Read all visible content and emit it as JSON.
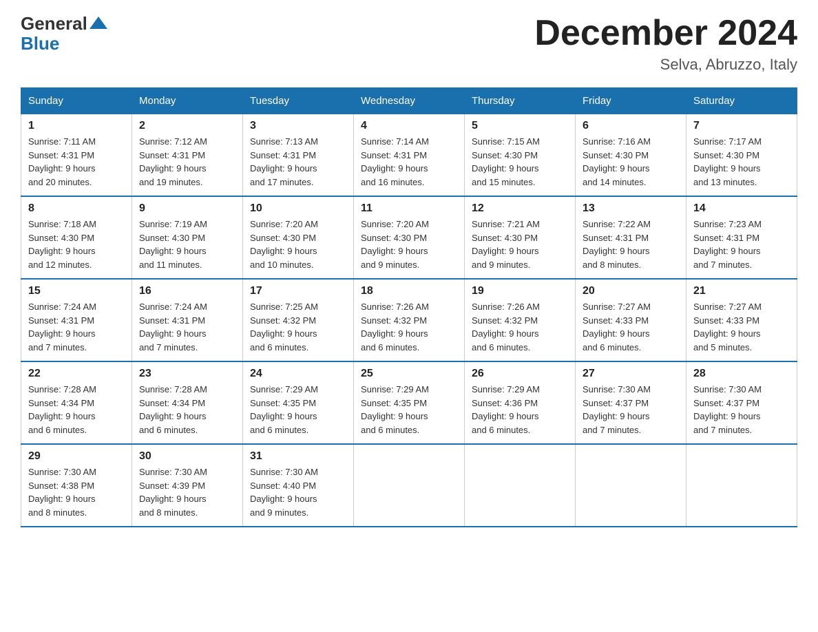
{
  "header": {
    "title": "December 2024",
    "subtitle": "Selva, Abruzzo, Italy",
    "logo_general": "General",
    "logo_blue": "Blue"
  },
  "days_of_week": [
    "Sunday",
    "Monday",
    "Tuesday",
    "Wednesday",
    "Thursday",
    "Friday",
    "Saturday"
  ],
  "weeks": [
    [
      {
        "day": "1",
        "sunrise": "7:11 AM",
        "sunset": "4:31 PM",
        "daylight": "9 hours and 20 minutes."
      },
      {
        "day": "2",
        "sunrise": "7:12 AM",
        "sunset": "4:31 PM",
        "daylight": "9 hours and 19 minutes."
      },
      {
        "day": "3",
        "sunrise": "7:13 AM",
        "sunset": "4:31 PM",
        "daylight": "9 hours and 17 minutes."
      },
      {
        "day": "4",
        "sunrise": "7:14 AM",
        "sunset": "4:31 PM",
        "daylight": "9 hours and 16 minutes."
      },
      {
        "day": "5",
        "sunrise": "7:15 AM",
        "sunset": "4:30 PM",
        "daylight": "9 hours and 15 minutes."
      },
      {
        "day": "6",
        "sunrise": "7:16 AM",
        "sunset": "4:30 PM",
        "daylight": "9 hours and 14 minutes."
      },
      {
        "day": "7",
        "sunrise": "7:17 AM",
        "sunset": "4:30 PM",
        "daylight": "9 hours and 13 minutes."
      }
    ],
    [
      {
        "day": "8",
        "sunrise": "7:18 AM",
        "sunset": "4:30 PM",
        "daylight": "9 hours and 12 minutes."
      },
      {
        "day": "9",
        "sunrise": "7:19 AM",
        "sunset": "4:30 PM",
        "daylight": "9 hours and 11 minutes."
      },
      {
        "day": "10",
        "sunrise": "7:20 AM",
        "sunset": "4:30 PM",
        "daylight": "9 hours and 10 minutes."
      },
      {
        "day": "11",
        "sunrise": "7:20 AM",
        "sunset": "4:30 PM",
        "daylight": "9 hours and 9 minutes."
      },
      {
        "day": "12",
        "sunrise": "7:21 AM",
        "sunset": "4:30 PM",
        "daylight": "9 hours and 9 minutes."
      },
      {
        "day": "13",
        "sunrise": "7:22 AM",
        "sunset": "4:31 PM",
        "daylight": "9 hours and 8 minutes."
      },
      {
        "day": "14",
        "sunrise": "7:23 AM",
        "sunset": "4:31 PM",
        "daylight": "9 hours and 7 minutes."
      }
    ],
    [
      {
        "day": "15",
        "sunrise": "7:24 AM",
        "sunset": "4:31 PM",
        "daylight": "9 hours and 7 minutes."
      },
      {
        "day": "16",
        "sunrise": "7:24 AM",
        "sunset": "4:31 PM",
        "daylight": "9 hours and 7 minutes."
      },
      {
        "day": "17",
        "sunrise": "7:25 AM",
        "sunset": "4:32 PM",
        "daylight": "9 hours and 6 minutes."
      },
      {
        "day": "18",
        "sunrise": "7:26 AM",
        "sunset": "4:32 PM",
        "daylight": "9 hours and 6 minutes."
      },
      {
        "day": "19",
        "sunrise": "7:26 AM",
        "sunset": "4:32 PM",
        "daylight": "9 hours and 6 minutes."
      },
      {
        "day": "20",
        "sunrise": "7:27 AM",
        "sunset": "4:33 PM",
        "daylight": "9 hours and 6 minutes."
      },
      {
        "day": "21",
        "sunrise": "7:27 AM",
        "sunset": "4:33 PM",
        "daylight": "9 hours and 5 minutes."
      }
    ],
    [
      {
        "day": "22",
        "sunrise": "7:28 AM",
        "sunset": "4:34 PM",
        "daylight": "9 hours and 6 minutes."
      },
      {
        "day": "23",
        "sunrise": "7:28 AM",
        "sunset": "4:34 PM",
        "daylight": "9 hours and 6 minutes."
      },
      {
        "day": "24",
        "sunrise": "7:29 AM",
        "sunset": "4:35 PM",
        "daylight": "9 hours and 6 minutes."
      },
      {
        "day": "25",
        "sunrise": "7:29 AM",
        "sunset": "4:35 PM",
        "daylight": "9 hours and 6 minutes."
      },
      {
        "day": "26",
        "sunrise": "7:29 AM",
        "sunset": "4:36 PM",
        "daylight": "9 hours and 6 minutes."
      },
      {
        "day": "27",
        "sunrise": "7:30 AM",
        "sunset": "4:37 PM",
        "daylight": "9 hours and 7 minutes."
      },
      {
        "day": "28",
        "sunrise": "7:30 AM",
        "sunset": "4:37 PM",
        "daylight": "9 hours and 7 minutes."
      }
    ],
    [
      {
        "day": "29",
        "sunrise": "7:30 AM",
        "sunset": "4:38 PM",
        "daylight": "9 hours and 8 minutes."
      },
      {
        "day": "30",
        "sunrise": "7:30 AM",
        "sunset": "4:39 PM",
        "daylight": "9 hours and 8 minutes."
      },
      {
        "day": "31",
        "sunrise": "7:30 AM",
        "sunset": "4:40 PM",
        "daylight": "9 hours and 9 minutes."
      },
      null,
      null,
      null,
      null
    ]
  ]
}
